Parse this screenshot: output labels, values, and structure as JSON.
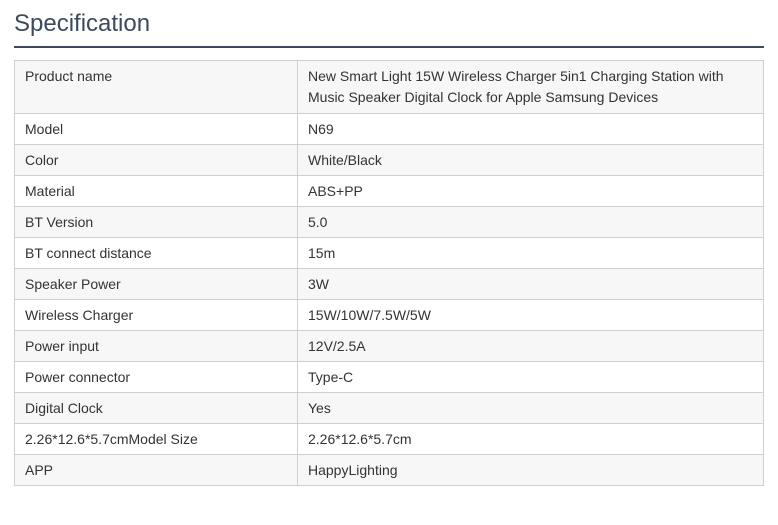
{
  "heading": "Specification",
  "rows": [
    {
      "label": "Product name",
      "value": "New Smart Light 15W Wireless Charger 5in1 Charging Station with Music Speaker Digital Clock for Apple Samsung Devices"
    },
    {
      "label": "Model",
      "value": "N69"
    },
    {
      "label": "Color",
      "value": "White/Black"
    },
    {
      "label": "Material",
      "value": "ABS+PP"
    },
    {
      "label": "BT Version",
      "value": "5.0"
    },
    {
      "label": "BT connect distance",
      "value": "15m"
    },
    {
      "label": "Speaker Power",
      "value": "3W"
    },
    {
      "label": "Wireless Charger",
      "value": "15W/10W/7.5W/5W"
    },
    {
      "label": "Power input",
      "value": "12V/2.5A"
    },
    {
      "label": "Power connector",
      "value": "Type-C"
    },
    {
      "label": "Digital Clock",
      "value": "Yes"
    },
    {
      "label": "2.26*12.6*5.7cmModel Size",
      "value": "2.26*12.6*5.7cm"
    },
    {
      "label": "APP",
      "value": "HappyLighting"
    }
  ]
}
